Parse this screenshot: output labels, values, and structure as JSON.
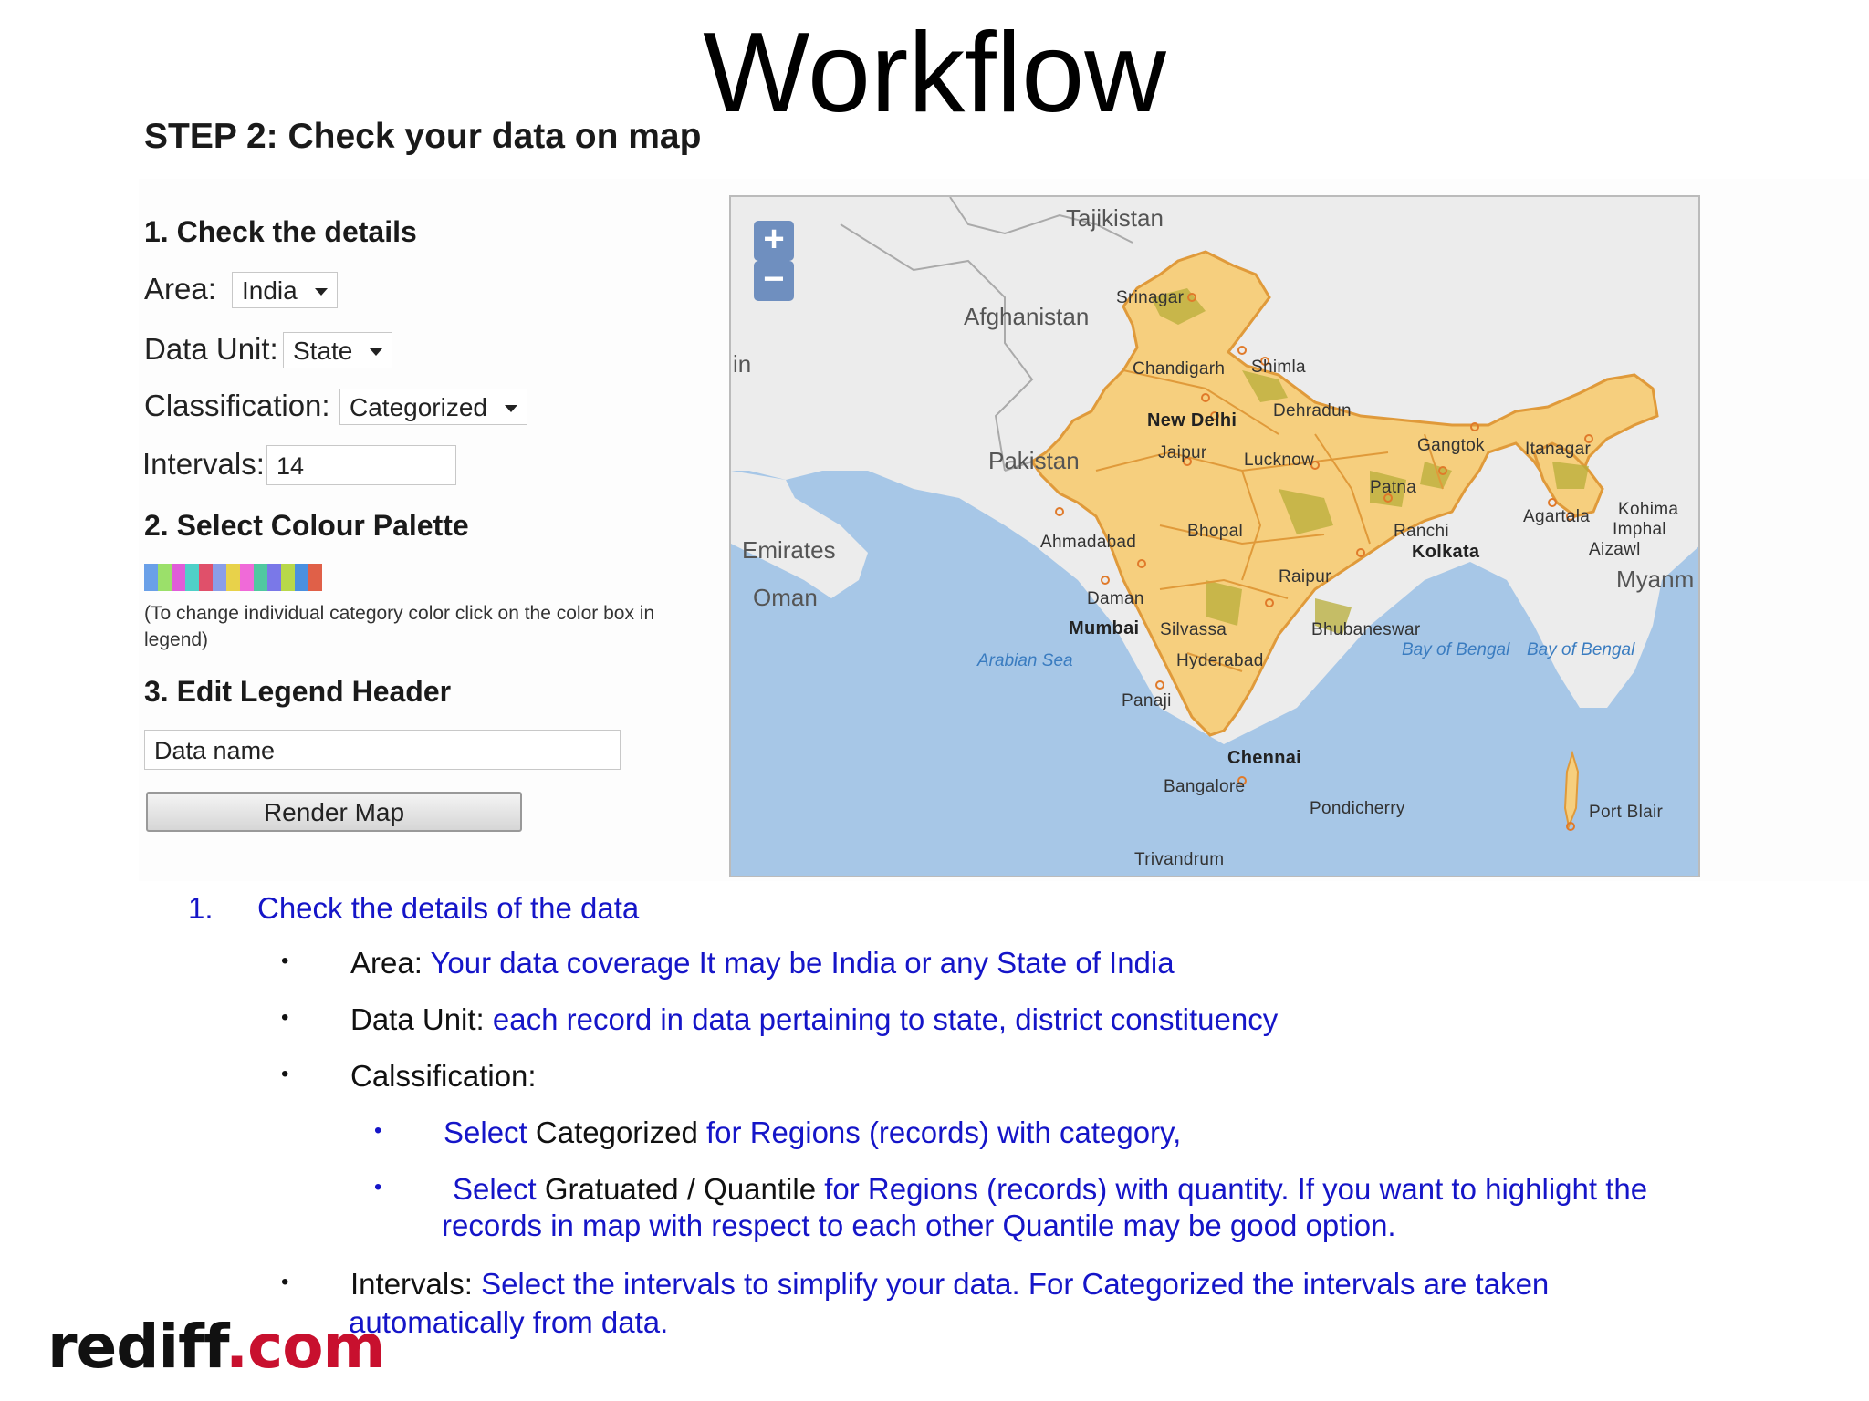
{
  "slide": {
    "title": "Workflow",
    "step_heading": "STEP 2: Check your data on map"
  },
  "form": {
    "section1_heading": "1. Check the details",
    "area_label": "Area:",
    "area_value": "India",
    "data_unit_label": "Data Unit:",
    "data_unit_value": "State",
    "classification_label": "Classification:",
    "classification_value": "Categorized",
    "intervals_label": "Intervals:",
    "intervals_value": "14",
    "section2_heading": "2. Select Colour Palette",
    "palette_colors": [
      "#6aa0e8",
      "#9be06a",
      "#e05cd8",
      "#4fd0c8",
      "#e0506a",
      "#8a9ee8",
      "#e8d24a",
      "#f06ad8",
      "#50c8a0",
      "#7a78e8",
      "#b8d84a",
      "#4a90e0",
      "#e06048"
    ],
    "palette_note": "(To change individual category color click on the color box in legend)",
    "section3_heading": "3. Edit Legend Header",
    "legend_header_value": "Data name",
    "render_button": "Render Map"
  },
  "map": {
    "zoom_in": "+",
    "zoom_out": "−",
    "countries": {
      "tajikistan": "Tajikistan",
      "afghanistan": "Afghanistan",
      "pakistan": "Pakistan",
      "emirates": "Emirates",
      "oman": "Oman",
      "myanmar": "Myanm",
      "iran_fragment": "in"
    },
    "seas": {
      "arabian": "Arabian Sea",
      "bengal1": "Bay of Bengal",
      "bengal2": "Bay of Bengal"
    },
    "cities": {
      "srinagar": "Srinagar",
      "chandigarh": "Chandigarh",
      "shimla": "Shimla",
      "dehradun": "Dehradun",
      "new_delhi": "New Delhi",
      "jaipur": "Jaipur",
      "lucknow": "Lucknow",
      "gangtok": "Gangtok",
      "itanagar": "Itanagar",
      "patna": "Patna",
      "kohima": "Kohima",
      "agartala": "Agartala",
      "imphal": "Imphal",
      "aizawl": "Aizawl",
      "ahmadabad": "Ahmadabad",
      "bhopal": "Bhopal",
      "ranchi": "Ranchi",
      "kolkata": "Kolkata",
      "raipur": "Raipur",
      "daman": "Daman",
      "mumbai": "Mumbai",
      "silvassa": "Silvassa",
      "bhubaneswar": "Bhubaneswar",
      "hyderabad": "Hyderabad",
      "panaji": "Panaji",
      "chennai": "Chennai",
      "bangalore": "Bangalore",
      "pondicherry": "Pondicherry",
      "port_blair": "Port Blair",
      "trivandrum": "Trivandrum"
    },
    "colors": {
      "water": "#a7c7e7",
      "land": "#ececec",
      "india": "#f6cf7e",
      "border": "#e09a3a"
    }
  },
  "notes": {
    "item1_number": "1.",
    "item1_text": "Check the details of the data",
    "area_key": "Area:",
    "area_desc": "Your data coverage It may be India or any State of India",
    "unit_key": "Data Unit:",
    "unit_desc": "each record in data pertaining to state, district constituency",
    "class_key": "Calssification:",
    "cat_select": "Select",
    "cat_word": "Categorized",
    "cat_desc": "for Regions (records) with category,",
    "grad_select": "Select",
    "grad_word": "Gratuated / Quantile",
    "grad_desc1": "for Regions (records) with quantity. If you want to highlight the",
    "grad_desc2": "records in map with respect to each other Quantile may be good option.",
    "int_key": "Intervals:",
    "int_desc1": "Select the intervals to simplify your data. For Categorized the intervals are taken",
    "int_desc2": "automatically from data.",
    "bullet": "•"
  },
  "logo": {
    "main": "rediff",
    "suffix": ".com"
  }
}
